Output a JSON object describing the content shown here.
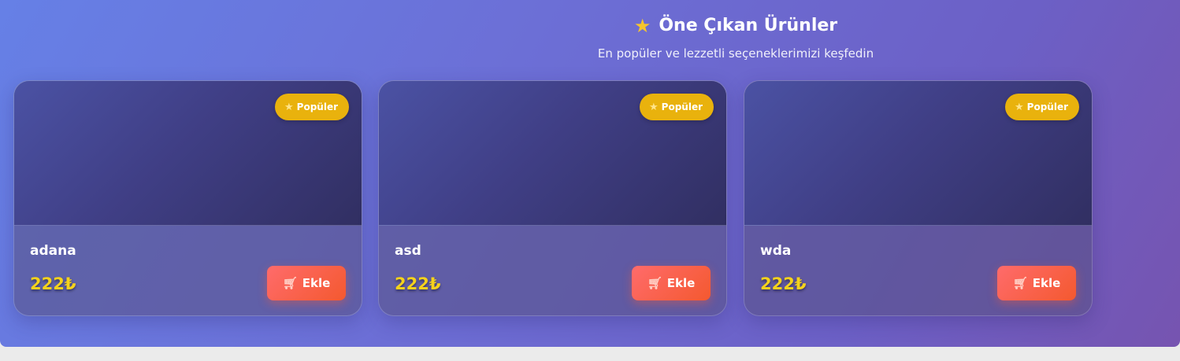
{
  "header": {
    "title_icon": "star-icon",
    "title": "Öne Çıkan Ürünler",
    "subtitle": "En popüler ve lezzetli seçeneklerimizi keşfedin"
  },
  "products": [
    {
      "badge": "Popüler",
      "name": "adana",
      "price": "222₺",
      "add_label": "Ekle"
    },
    {
      "badge": "Popüler",
      "name": "asd",
      "price": "222₺",
      "add_label": "Ekle"
    },
    {
      "badge": "Popüler",
      "name": "wda",
      "price": "222₺",
      "add_label": "Ekle"
    }
  ],
  "colors": {
    "accent": "#ff6b6b",
    "price": "#f5d21c",
    "badge": "#e9b20d"
  }
}
